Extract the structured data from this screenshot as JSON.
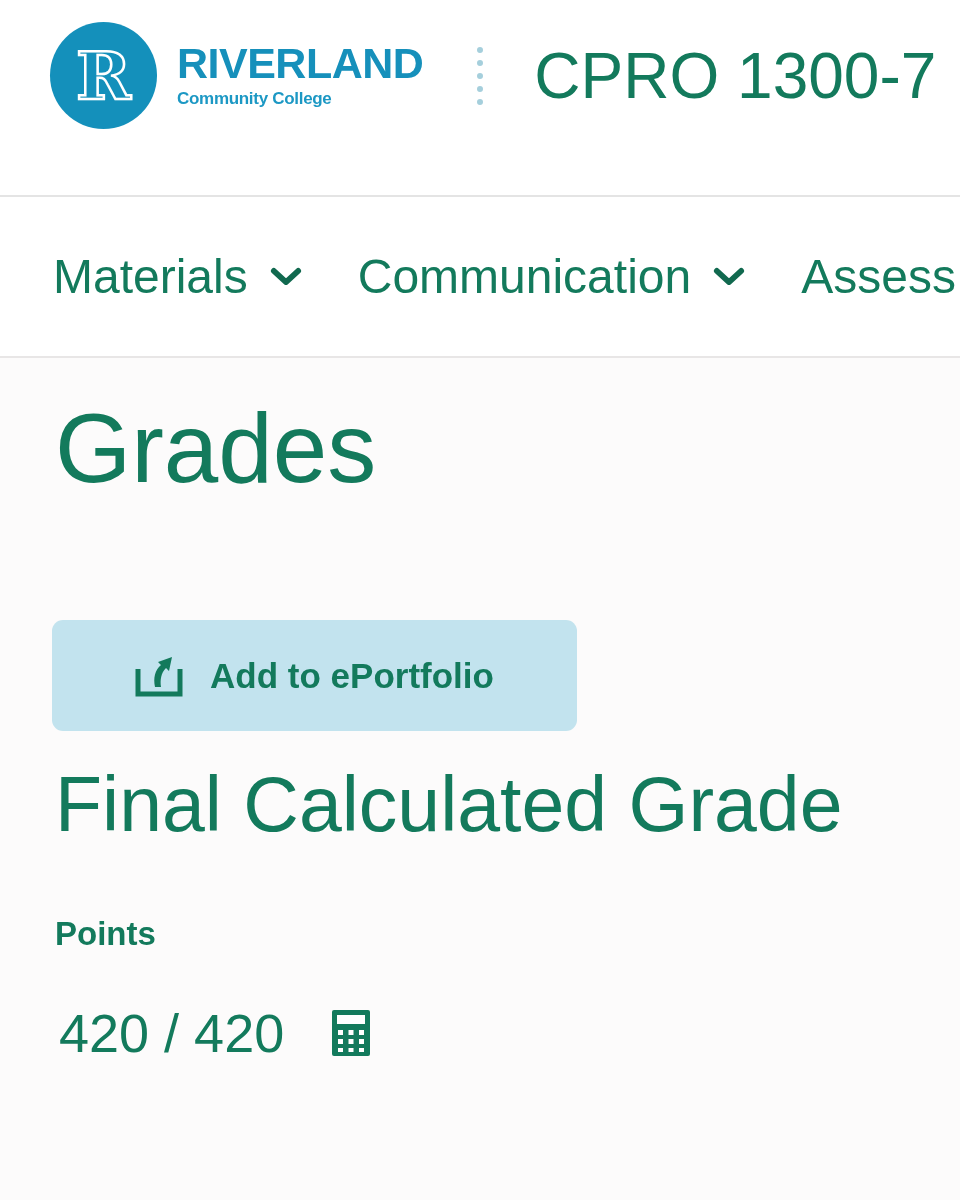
{
  "header": {
    "logo": {
      "monogram": "R",
      "name": "RIVERLAND",
      "tagline": "Community College"
    },
    "course_title": "CPRO 1300-7"
  },
  "nav": {
    "items": [
      {
        "label": "Materials",
        "dropdown": true
      },
      {
        "label": "Communication",
        "dropdown": true
      },
      {
        "label": "Assess",
        "dropdown": false
      }
    ]
  },
  "page": {
    "title": "Grades",
    "add_button": {
      "label": "Add to ePortfolio"
    },
    "section_title": "Final Calculated Grade",
    "points": {
      "label": "Points",
      "value": "420 / 420"
    }
  }
}
